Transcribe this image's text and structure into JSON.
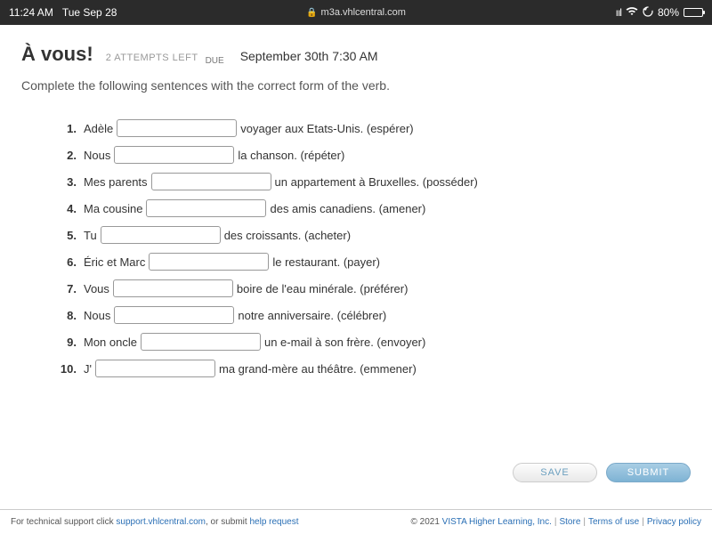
{
  "status_bar": {
    "time": "11:24 AM",
    "date": "Tue Sep 28",
    "url": "m3a.vhlcentral.com",
    "battery_pct": "80%"
  },
  "header": {
    "title": "À vous!",
    "attempts": "2 ATTEMPTS LEFT",
    "due_label": "DUE",
    "due_date": "September 30th 7:30 AM"
  },
  "instructions": "Complete the following sentences with the correct form of the verb.",
  "questions": [
    {
      "num": "1.",
      "pre": "Adèle ",
      "post": " voyager aux Etats-Unis. (espérer)"
    },
    {
      "num": "2.",
      "pre": "Nous ",
      "post": " la chanson. (répéter)"
    },
    {
      "num": "3.",
      "pre": "Mes parents ",
      "post": " un appartement à Bruxelles. (posséder)"
    },
    {
      "num": "4.",
      "pre": "Ma cousine ",
      "post": " des amis canadiens. (amener)"
    },
    {
      "num": "5.",
      "pre": "Tu ",
      "post": " des croissants. (acheter)"
    },
    {
      "num": "6.",
      "pre": "Éric et Marc ",
      "post": " le restaurant. (payer)"
    },
    {
      "num": "7.",
      "pre": "Vous ",
      "post": " boire de l'eau minérale. (préférer)"
    },
    {
      "num": "8.",
      "pre": "Nous ",
      "post": " notre anniversaire. (célébrer)"
    },
    {
      "num": "9.",
      "pre": "Mon oncle ",
      "post": " un e-mail à son frère. (envoyer)"
    },
    {
      "num": "10.",
      "pre": "J'",
      "post": " ma grand-mère au théâtre. (emmener)"
    }
  ],
  "actions": {
    "save": "SAVE",
    "submit": "SUBMIT"
  },
  "footer": {
    "support_pre": "For technical support click ",
    "support_link": "support.vhlcentral.com",
    "support_mid": ", or submit ",
    "help_link": "help request",
    "copyright": "© 2021 ",
    "company": "VISTA Higher Learning, Inc.",
    "store": "Store",
    "terms": "Terms of use",
    "privacy": "Privacy policy"
  }
}
